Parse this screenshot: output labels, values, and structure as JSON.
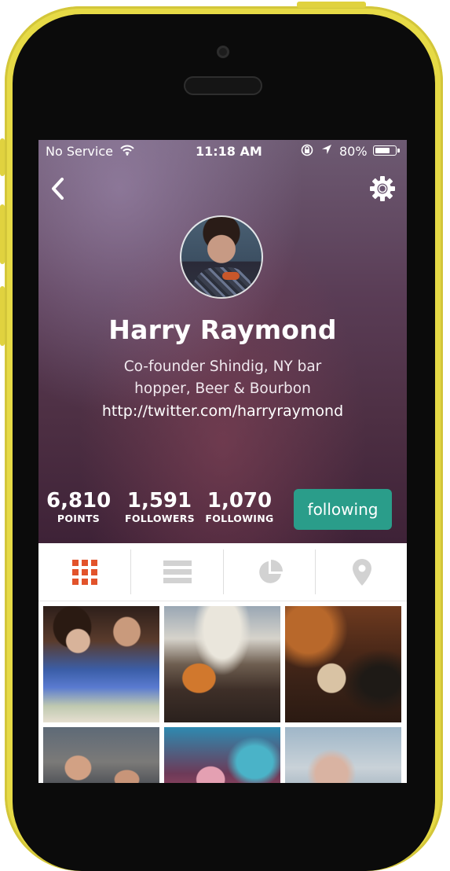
{
  "status_bar": {
    "carrier": "No Service",
    "time": "11:18 AM",
    "battery_percent": "80%",
    "battery_level": 0.8
  },
  "nav": {
    "back_icon": "chevron-left-icon",
    "settings_icon": "gear-icon"
  },
  "profile": {
    "name": "Harry Raymond",
    "bio": "Co-founder Shindig, NY bar hopper, Beer & Bourbon",
    "url": "http://twitter.com/harryraymond"
  },
  "stats": [
    {
      "value": "6,810",
      "label": "POINTS"
    },
    {
      "value": "1,591",
      "label": "FOLLOWERS"
    },
    {
      "value": "1,070",
      "label": "FOLLOWING"
    }
  ],
  "follow_button": {
    "label": "following"
  },
  "tabs": [
    {
      "icon": "grid-icon",
      "active": true
    },
    {
      "icon": "list-icon",
      "active": false
    },
    {
      "icon": "pie-chart-icon",
      "active": false
    },
    {
      "icon": "location-pin-icon",
      "active": false
    }
  ],
  "colors": {
    "accent": "#e2532b",
    "follow_button": "#2a9d8a",
    "inactive_icon": "#d2d2d2",
    "phone_shell": "#e6da46"
  }
}
